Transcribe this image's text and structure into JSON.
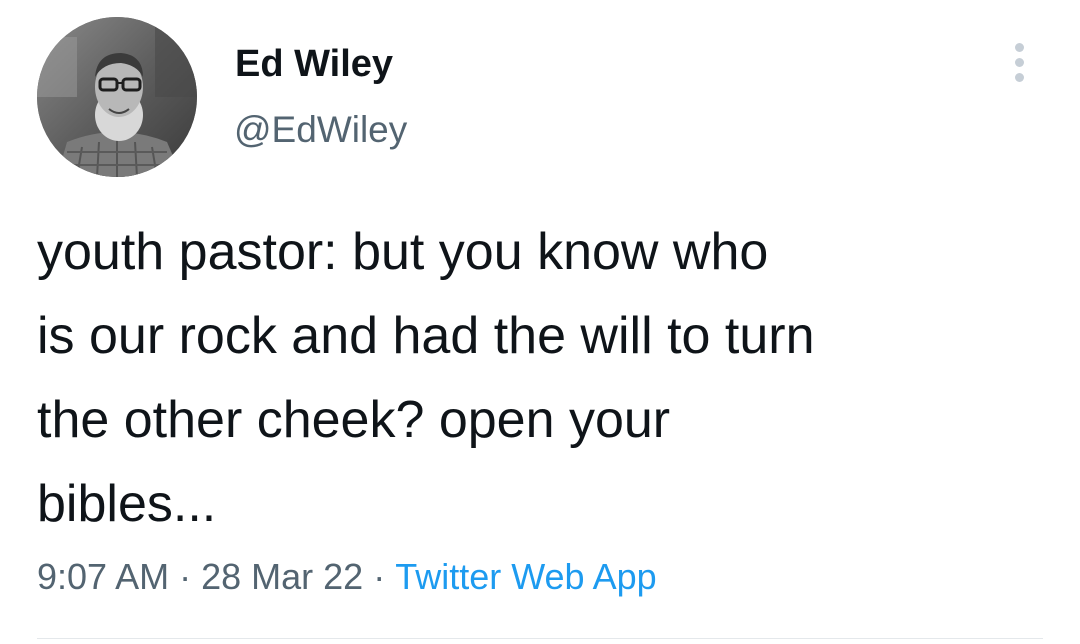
{
  "author": {
    "name": "Ed Wiley",
    "handle": "@EdWiley",
    "avatar_icon": "profile-photo"
  },
  "menu_icon": "more-vertical-icon",
  "tweet": {
    "text": "youth pastor: but you know who\nis our rock and had the will to turn\nthe other cheek? open your\nbibles..."
  },
  "meta": {
    "time": "9:07 AM",
    "separator": "·",
    "date": "28 Mar 22",
    "source": "Twitter Web App"
  },
  "colors": {
    "text": "#0f1419",
    "secondary": "#536471",
    "link": "#1d9bf0"
  }
}
